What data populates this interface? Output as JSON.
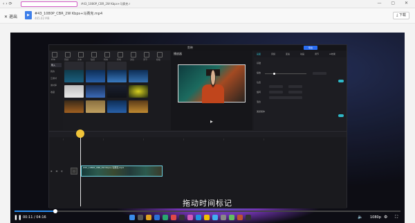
{
  "browser": {
    "active_tab": "",
    "inactive_tab": "#43_1080P_CBR_2W Kbps+马赛克.mp4"
  },
  "header": {
    "back_label": "退出",
    "file_name": "#43_1080P_CBR_2W Kbps+马赛克.mp4",
    "file_size": "465.02 MB",
    "download_label": "下载"
  },
  "editor": {
    "title": "剪映",
    "export_label": "导出",
    "tools": [
      "媒体",
      "音频",
      "文本",
      "贴纸",
      "特效",
      "转场",
      "滤镜",
      "调节",
      "模板"
    ],
    "sidebar": [
      "导入",
      "我的",
      "云素材",
      "素材库",
      "收藏"
    ],
    "preview_label": "播放器",
    "right_tabs": [
      "画面",
      "音频",
      "变速",
      "动画",
      "调节",
      "AI效果"
    ],
    "right_rows": [
      "基础",
      "缩放",
      "位置",
      "旋转",
      "混合",
      "美颜美体"
    ]
  },
  "player": {
    "subtitle": "拖动时间标记",
    "current_time": "00:11",
    "total_time": "04:16",
    "quality": "1080p",
    "progress": 0.105
  },
  "colors": {
    "accent": "#2b8ef0",
    "clip_border": "#6fd2e0",
    "playhead": "#f0c43a"
  }
}
